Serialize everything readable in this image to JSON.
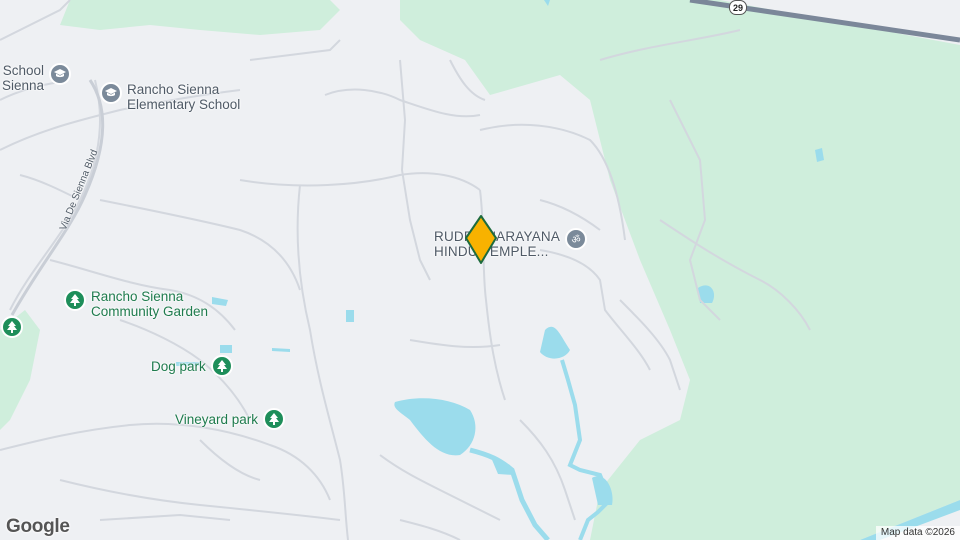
{
  "map": {
    "colors": {
      "land": "#eef0f3",
      "green": "#cfeedc",
      "water": "#9bdcec",
      "road": "#d3d7de",
      "highway": "#7b8799",
      "marker": "#f8b200"
    },
    "pois": [
      {
        "name": "school-top-left",
        "label": "School\nSienna",
        "type": "school",
        "icon": "school-icon"
      },
      {
        "name": "rancho-sienna-elementary",
        "label": "Rancho Sienna\nElementary School",
        "type": "school",
        "icon": "school-icon"
      },
      {
        "name": "rancho-sienna-community-garden",
        "label": "Rancho Sienna\nCommunity Garden",
        "type": "park",
        "icon": "tree-icon"
      },
      {
        "name": "dog-park",
        "label": "Dog park",
        "type": "park",
        "icon": "tree-icon"
      },
      {
        "name": "vineyard-park",
        "label": "Vineyard park",
        "type": "park",
        "icon": "tree-icon"
      },
      {
        "name": "temple",
        "label": "RUDRA NARAYANA\nHINDU TEMPLE...",
        "type": "temple",
        "icon": "om-icon"
      }
    ],
    "roads": {
      "via_de_sienna": "Via De Sienna Blvd",
      "route_shield": "29"
    },
    "footer": {
      "logo": "Google",
      "attribution": "Map data ©2026"
    }
  }
}
